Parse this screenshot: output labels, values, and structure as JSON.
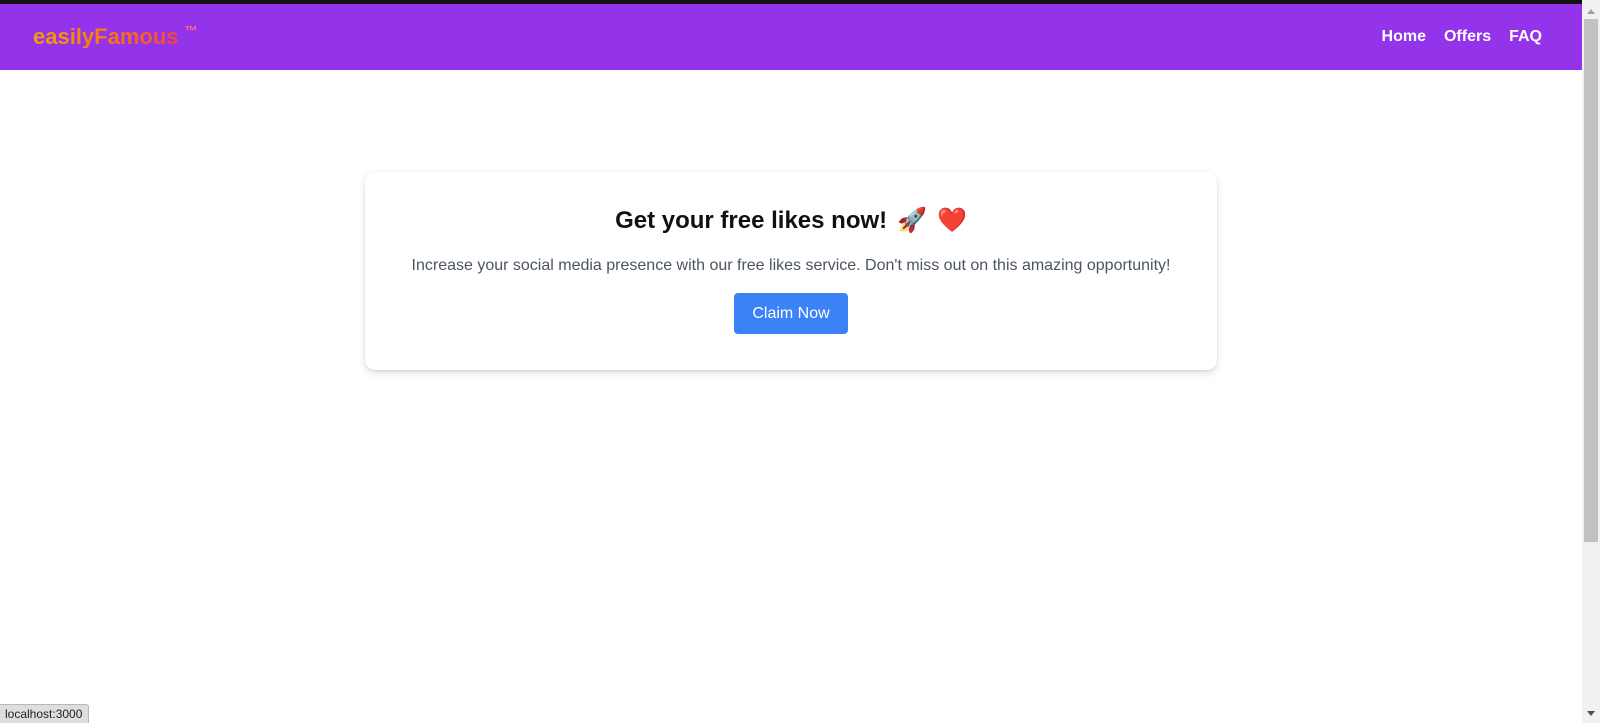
{
  "header": {
    "brand_name": "easilyFamous",
    "brand_tm": "™",
    "nav": [
      {
        "label": "Home"
      },
      {
        "label": "Offers"
      },
      {
        "label": "FAQ"
      }
    ]
  },
  "card": {
    "title": "Get your free likes now!",
    "title_emojis": [
      "🚀",
      "❤️"
    ],
    "description": "Increase your social media presence with our free likes service. Don't miss out on this amazing opportunity!",
    "button_label": "Claim Now"
  },
  "status_bar": {
    "url": "localhost:3000"
  },
  "colors": {
    "navbar_bg": "#9333ea",
    "button_bg": "#3b82f6",
    "brand_gradient": [
      "#f59e0b",
      "#ef4444"
    ]
  }
}
